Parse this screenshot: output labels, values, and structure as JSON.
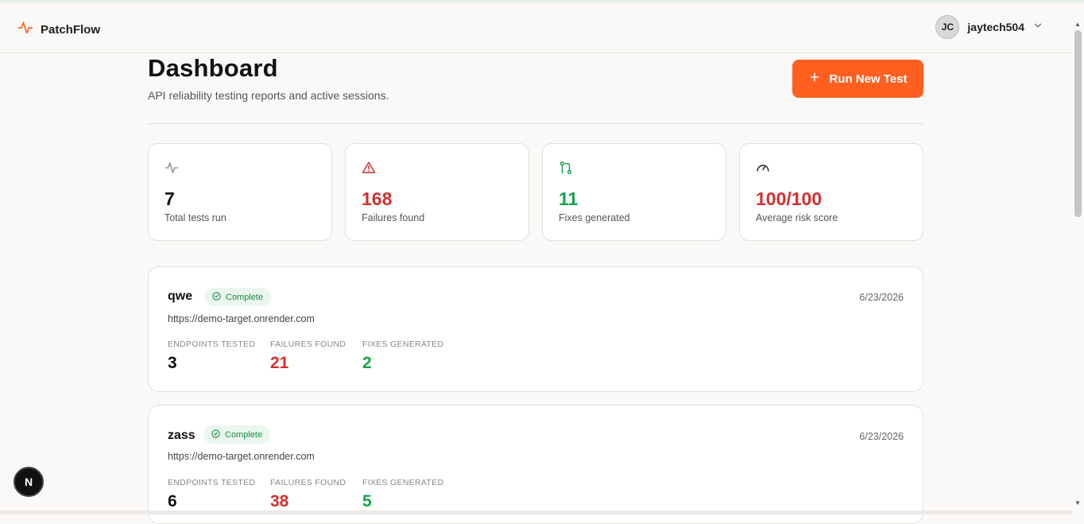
{
  "header": {
    "brand": "PatchFlow",
    "username": "jaytech504",
    "avatar_initials": "JC",
    "icons": {
      "brand": "pulse-icon",
      "chevron": "chevron-down-icon"
    }
  },
  "page": {
    "title": "Dashboard",
    "subtitle": "API reliability testing reports and active sessions.",
    "run_button": "Run New Test"
  },
  "stats": [
    {
      "icon": "pulse-icon",
      "value": "7",
      "label": "Total tests run",
      "color": "#111111"
    },
    {
      "icon": "alert-triangle-icon",
      "value": "168",
      "label": "Failures found",
      "color": "#d32f2f"
    },
    {
      "icon": "git-pull-request-icon",
      "value": "11",
      "label": "Fixes generated",
      "color": "#16a34a"
    },
    {
      "icon": "gauge-icon",
      "value": "100/100",
      "label": "Average risk score",
      "color": "#d32f2f"
    }
  ],
  "runs": [
    {
      "name": "qwe",
      "status": "Complete",
      "date": "6/23/2026",
      "url": "https://demo-target.onrender.com",
      "metrics": [
        {
          "label": "ENDPOINTS TESTED",
          "value": "3"
        },
        {
          "label": "FAILURES FOUND",
          "value": "21"
        },
        {
          "label": "FIXES GENERATED",
          "value": "2"
        }
      ]
    },
    {
      "name": "zass",
      "status": "Complete",
      "date": "6/23/2026",
      "url": "https://demo-target.onrender.com",
      "metrics": [
        {
          "label": "ENDPOINTS TESTED",
          "value": "6"
        },
        {
          "label": "FAILURES FOUND",
          "value": "38"
        },
        {
          "label": "FIXES GENERATED",
          "value": "5"
        }
      ]
    }
  ],
  "fab_label": "N",
  "colors": {
    "accent": "#ff5f1f",
    "danger": "#d32f2f",
    "success": "#16a34a"
  }
}
